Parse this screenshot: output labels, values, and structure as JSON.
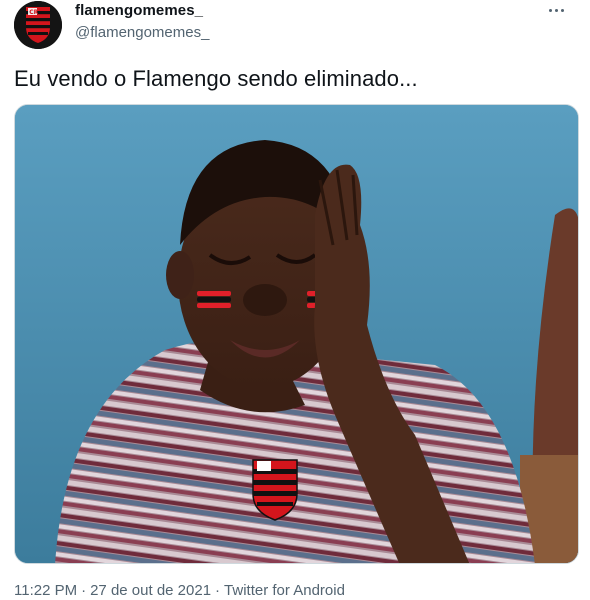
{
  "tweet": {
    "author": {
      "display_name": "flamengomemes_",
      "handle": "@flamengomemes_",
      "avatar": "flamengo-crest-avatar"
    },
    "more_icon": "more-horizontal-icon",
    "text": "Eu vendo o Flamengo sendo eliminado...",
    "media": {
      "type": "image",
      "description": "crying-kid-meme-with-flamengo-crest"
    },
    "footer": {
      "time": "11:22 PM",
      "separator": "·",
      "date": "27 de out de 2021",
      "source": "Twitter for Android"
    }
  },
  "colors": {
    "text_primary": "#0f1419",
    "text_secondary": "#536471",
    "flamengo_red": "#d4151c",
    "flamengo_black": "#111111"
  }
}
